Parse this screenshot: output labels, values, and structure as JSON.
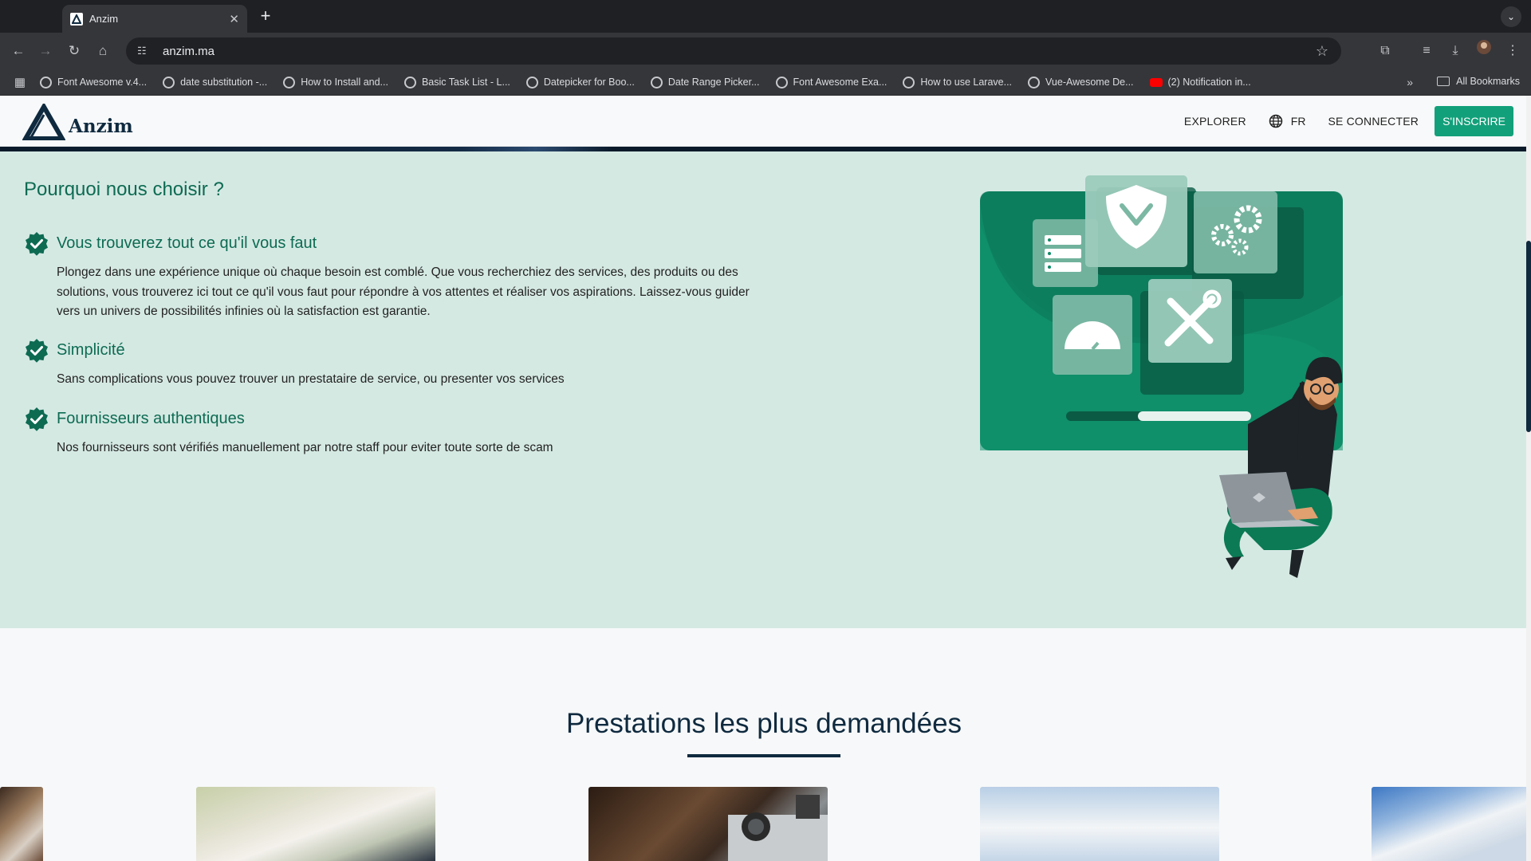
{
  "browser": {
    "tab_title": "Anzim",
    "tab_close": "✕",
    "new_tab": "+",
    "url": "anzim.ma",
    "bookmarks": [
      "Font Awesome v.4...",
      "date substitution -...",
      "How to Install and...",
      "Basic Task List - L...",
      "Datepicker for Boo...",
      "Date Range Picker...",
      "Font Awesome Exa...",
      "How to use Larave...",
      "Vue-Awesome De...",
      "(2) Notification in..."
    ],
    "all_bookmarks": "All Bookmarks"
  },
  "header": {
    "logo_text": "Anzim",
    "nav_explorer": "EXPLORER",
    "nav_lang": "FR",
    "nav_login": "SE CONNECTER",
    "nav_signup": "S'INSCRIRE"
  },
  "why": {
    "title": "Pourquoi nous choisir ?",
    "features": [
      {
        "title": "Vous trouverez tout ce qu'il vous faut",
        "text": "Plongez dans une expérience unique où chaque besoin est comblé. Que vous recherchiez des services, des produits ou des solutions, vous trouverez ici tout ce qu'il vous faut pour répondre à vos attentes et réaliser vos aspirations. Laissez-vous guider vers un univers de possibilités infinies où la satisfaction est garantie."
      },
      {
        "title": "Simplicité",
        "text": "Sans complications vous pouvez trouver un prestataire de service, ou presenter vos services"
      },
      {
        "title": "Fournisseurs authentiques",
        "text": "Nos fournisseurs sont vérifiés manuellement par notre staff pour eviter toute sorte de scam"
      }
    ]
  },
  "popular": {
    "title": "Prestations les plus demandées"
  },
  "colors": {
    "brand_green": "#12a07a",
    "heading_green": "#0d6b52",
    "navy": "#0f2a3f",
    "section_bg": "#d5e9e3"
  }
}
